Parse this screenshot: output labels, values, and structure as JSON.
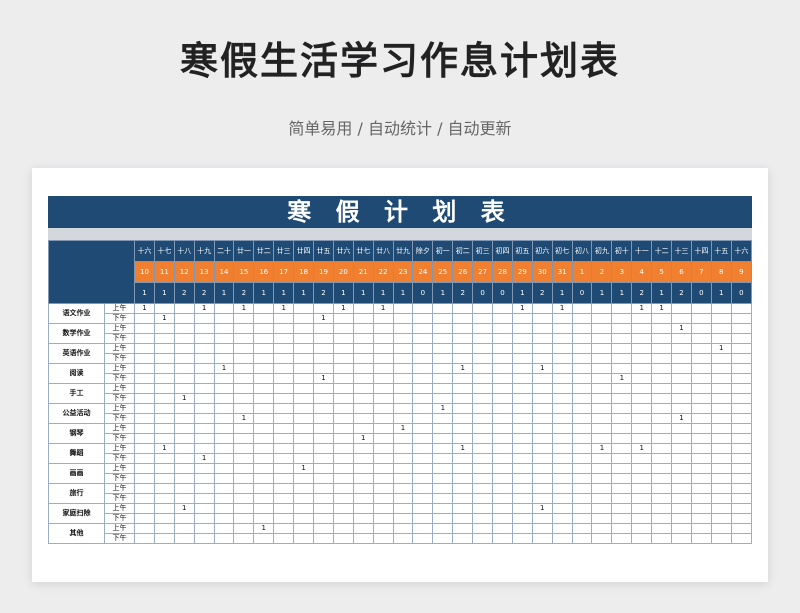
{
  "title": "寒假生活学习作息计划表",
  "subtitle": "简单易用 / 自动统计 / 自动更新",
  "sheet_title": "寒 假 计 划 表",
  "lunar": [
    "十六",
    "十七",
    "十八",
    "十九",
    "二十",
    "廿一",
    "廿二",
    "廿三",
    "廿四",
    "廿五",
    "廿六",
    "廿七",
    "廿八",
    "廿九",
    "除夕",
    "初一",
    "初二",
    "初三",
    "初四",
    "初五",
    "初六",
    "初七",
    "初八",
    "初九",
    "初十",
    "十一",
    "十二",
    "十三",
    "十四",
    "十五",
    "十六"
  ],
  "dates": [
    "10",
    "11",
    "12",
    "13",
    "14",
    "15",
    "16",
    "17",
    "18",
    "19",
    "20",
    "21",
    "22",
    "23",
    "24",
    "25",
    "26",
    "27",
    "28",
    "29",
    "30",
    "31",
    "1",
    "2",
    "3",
    "4",
    "5",
    "6",
    "7",
    "8",
    "9"
  ],
  "totals": [
    "1",
    "1",
    "2",
    "2",
    "1",
    "2",
    "1",
    "1",
    "1",
    "2",
    "1",
    "1",
    "1",
    "1",
    "0",
    "1",
    "2",
    "0",
    "0",
    "1",
    "2",
    "1",
    "0",
    "1",
    "1",
    "2",
    "1",
    "2",
    "0",
    "1",
    "0"
  ],
  "am_label": "上午",
  "pm_label": "下午",
  "rows": [
    {
      "category": "语文作业",
      "am": {
        "0": "1",
        "3": "1",
        "5": "1",
        "7": "1",
        "10": "1",
        "12": "1",
        "19": "1",
        "21": "1",
        "25": "1",
        "26": "1"
      },
      "pm": {
        "1": "1",
        "9": "1"
      }
    },
    {
      "category": "数学作业",
      "am": {
        "27": "1"
      },
      "pm": {}
    },
    {
      "category": "英语作业",
      "am": {
        "29": "1"
      },
      "pm": {}
    },
    {
      "category": "阅读",
      "am": {
        "4": "1",
        "16": "1",
        "20": "1"
      },
      "pm": {
        "9": "1",
        "24": "1"
      }
    },
    {
      "category": "手工",
      "am": {},
      "pm": {
        "2": "1"
      }
    },
    {
      "category": "公益活动",
      "am": {
        "15": "1"
      },
      "pm": {
        "5": "1",
        "27": "1"
      }
    },
    {
      "category": "钢琴",
      "am": {
        "13": "1"
      },
      "pm": {
        "11": "1"
      }
    },
    {
      "category": "舞蹈",
      "am": {
        "1": "1",
        "16": "1",
        "23": "1",
        "25": "1"
      },
      "pm": {
        "3": "1"
      }
    },
    {
      "category": "画画",
      "am": {
        "8": "1"
      },
      "pm": {}
    },
    {
      "category": "旅行",
      "am": {},
      "pm": {}
    },
    {
      "category": "家庭扫除",
      "am": {
        "2": "1",
        "20": "1"
      },
      "pm": {}
    },
    {
      "category": "其他",
      "am": {
        "6": "1"
      },
      "pm": {}
    }
  ],
  "colors": {
    "header_blue": "#1e4a74",
    "date_orange": "#f07f2f"
  }
}
